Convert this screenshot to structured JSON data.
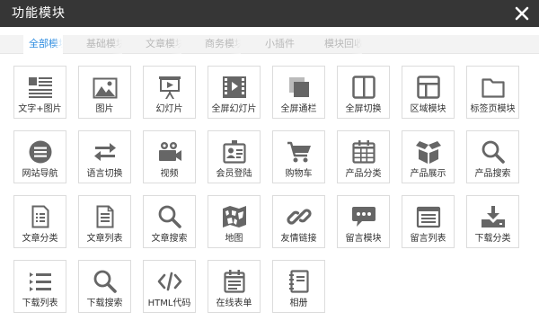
{
  "dialog": {
    "title": "功能模块",
    "close_icon": "close-icon"
  },
  "tabs": [
    {
      "label": "全部模块",
      "active": true
    },
    {
      "label": "基础模块",
      "active": false
    },
    {
      "label": "文章模块",
      "active": false
    },
    {
      "label": "商务模块",
      "active": false
    },
    {
      "label": "小插件",
      "active": false
    },
    {
      "label": "模块回收",
      "active": false
    }
  ],
  "colors": {
    "titlebar": "#363636",
    "active_tab": "#2d8ce0",
    "icon": "#666666",
    "tile_border": "#dcdcdc"
  },
  "modules": [
    {
      "label": "文字+图片",
      "icon": "text-image-icon"
    },
    {
      "label": "图片",
      "icon": "image-icon"
    },
    {
      "label": "幻灯片",
      "icon": "slideshow-icon"
    },
    {
      "label": "全屏幻灯片",
      "icon": "fullscreen-slideshow-icon"
    },
    {
      "label": "全屏通栏",
      "icon": "fullscreen-banner-icon"
    },
    {
      "label": "全屏切换",
      "icon": "fullscreen-switch-icon"
    },
    {
      "label": "区域模块",
      "icon": "region-module-icon"
    },
    {
      "label": "标签页模块",
      "icon": "tab-folder-icon"
    },
    {
      "label": "网站导航",
      "icon": "site-nav-icon"
    },
    {
      "label": "语言切换",
      "icon": "language-switch-icon"
    },
    {
      "label": "视频",
      "icon": "video-camera-icon"
    },
    {
      "label": "会员登陆",
      "icon": "member-login-icon"
    },
    {
      "label": "购物车",
      "icon": "shopping-cart-icon"
    },
    {
      "label": "产品分类",
      "icon": "product-category-icon"
    },
    {
      "label": "产品展示",
      "icon": "product-box-icon"
    },
    {
      "label": "产品搜索",
      "icon": "product-search-icon"
    },
    {
      "label": "文章分类",
      "icon": "article-category-icon"
    },
    {
      "label": "文章列表",
      "icon": "article-list-icon"
    },
    {
      "label": "文章搜索",
      "icon": "article-search-icon"
    },
    {
      "label": "地图",
      "icon": "map-icon"
    },
    {
      "label": "友情链接",
      "icon": "link-icon"
    },
    {
      "label": "留言模块",
      "icon": "message-bubble-icon"
    },
    {
      "label": "留言列表",
      "icon": "message-list-icon"
    },
    {
      "label": "下载分类",
      "icon": "download-category-icon"
    },
    {
      "label": "下载列表",
      "icon": "download-list-icon"
    },
    {
      "label": "下载搜索",
      "icon": "download-search-icon"
    },
    {
      "label": "HTML代码",
      "icon": "html-code-icon"
    },
    {
      "label": "在线表单",
      "icon": "online-form-icon"
    },
    {
      "label": "相册",
      "icon": "photo-album-icon"
    }
  ]
}
